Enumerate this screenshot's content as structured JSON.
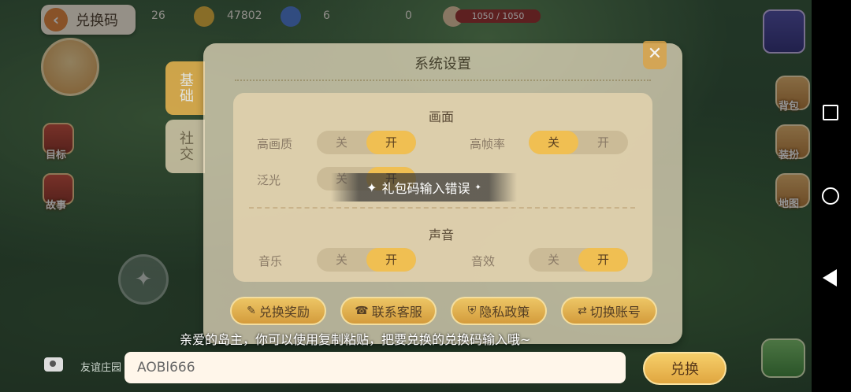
{
  "header": {
    "back_icon": "chevron-left-icon",
    "title": "兑换码"
  },
  "hud": {
    "value_1": "26",
    "value_2": "47802",
    "value_3": "6",
    "value_4": "0",
    "hp": "1050 / 1050"
  },
  "left_sidebar": {
    "items": [
      {
        "label": "目标",
        "icon": "target-icon"
      },
      {
        "label": "故事",
        "icon": "story-icon"
      }
    ]
  },
  "right_sidebar": {
    "items": [
      {
        "label": "背包",
        "icon": "backpack-icon"
      },
      {
        "label": "装扮",
        "icon": "dressup-icon"
      },
      {
        "label": "地图",
        "icon": "map-icon"
      }
    ]
  },
  "settings_dialog": {
    "title": "系统设置",
    "close_label": "✕",
    "tabs": [
      {
        "label": "基础",
        "active": true
      },
      {
        "label": "社交",
        "active": false
      }
    ],
    "display_section": {
      "title": "画面",
      "rows": [
        {
          "label": "高画质",
          "off": "关",
          "on": "开",
          "value": "on"
        },
        {
          "label": "高帧率",
          "off": "关",
          "on": "开",
          "value": "off"
        },
        {
          "label": "泛光",
          "off": "关",
          "on": "开",
          "value": "on"
        }
      ]
    },
    "sound_section": {
      "title": "声音",
      "rows": [
        {
          "label": "音乐",
          "off": "关",
          "on": "开",
          "value": "on"
        },
        {
          "label": "音效",
          "off": "关",
          "on": "开",
          "value": "on"
        }
      ]
    },
    "actions": [
      {
        "label": "兑换奖励",
        "icon": "pencil-icon"
      },
      {
        "label": "联系客服",
        "icon": "headset-icon"
      },
      {
        "label": "隐私政策",
        "icon": "shield-icon"
      },
      {
        "label": "切换账号",
        "icon": "swap-icon"
      }
    ]
  },
  "toast": {
    "message": "礼包码输入错误"
  },
  "redeem_form": {
    "hint": "亲爱的岛主，你可以使用复制粘贴，把要兑换的兑换码输入哦~",
    "input_value": "AOBl666",
    "submit_label": "兑换"
  },
  "bottom_bar": {
    "friend_label": "友谊庄园"
  }
}
